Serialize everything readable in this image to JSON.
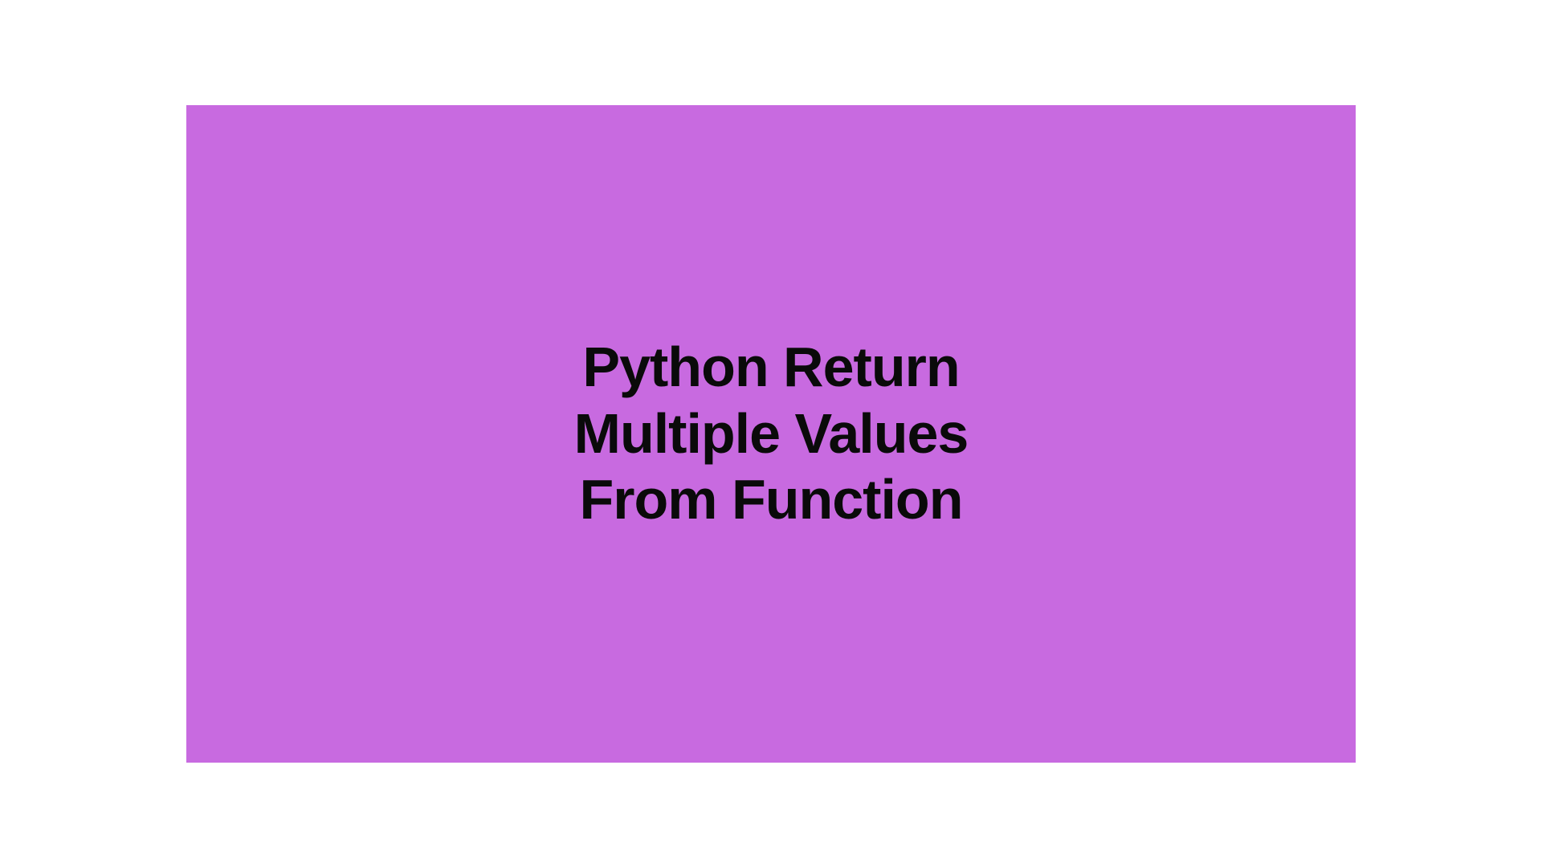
{
  "title": {
    "line1": "Python Return",
    "line2": "Multiple Values",
    "line3": "From Function"
  },
  "colors": {
    "background": "#c86ae0",
    "text": "#0a0a0a"
  }
}
